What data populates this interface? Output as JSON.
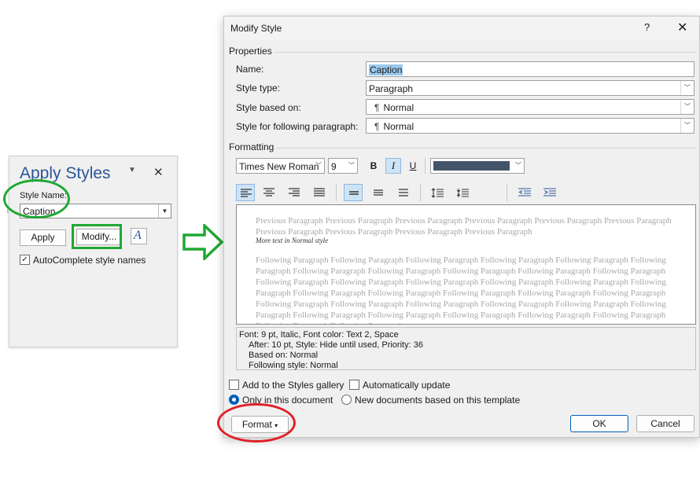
{
  "apply_styles": {
    "title": "Apply Styles",
    "style_name_label": "Style Name:",
    "style_name_value": "Caption",
    "apply_label": "Apply",
    "modify_label": "Modify...",
    "styles_pane_glyph": "A",
    "autocomplete_label": "AutoComplete style names",
    "autocomplete_checked": true
  },
  "dialog": {
    "title": "Modify Style",
    "help": "?",
    "close": "✕",
    "properties_label": "Properties",
    "name_label": "Name:",
    "name_value": "Caption",
    "style_type_label": "Style type:",
    "style_type_value": "Paragraph",
    "based_on_label": "Style based on:",
    "based_on_value": "Normal",
    "following_label": "Style for following paragraph:",
    "following_value": "Normal",
    "formatting_label": "Formatting",
    "font_value": "Times New Roman",
    "size_value": "9",
    "bold": "B",
    "italic": "I",
    "underline": "U",
    "font_color": "#44546a",
    "preview_previous": "Previous Paragraph Previous Paragraph Previous Paragraph Previous Paragraph Previous Paragraph Previous Paragraph Previous Paragraph Previous Paragraph Previous Paragraph Previous Paragraph",
    "preview_sample": "More text in Normal style",
    "preview_following": "Following Paragraph Following Paragraph Following Paragraph Following Paragraph Following Paragraph Following Paragraph Following Paragraph Following Paragraph Following Paragraph Following Paragraph Following Paragraph Following Paragraph Following Paragraph Following Paragraph Following Paragraph Following Paragraph Following Paragraph Following Paragraph Following Paragraph Following Paragraph Following Paragraph Following Paragraph Following Paragraph Following Paragraph Following Paragraph Following Paragraph Following Paragraph Following Paragraph Following Paragraph Following Paragraph Following Paragraph Following Paragraph Following Paragraph Following Paragraph Following Paragraph",
    "desc_line1": "Font: 9 pt, Italic, Font color: Text 2, Space",
    "desc_line2": "After:  10 pt, Style: Hide until used, Priority: 36",
    "desc_line3": "Based on: Normal",
    "desc_line4": "Following style: Normal",
    "add_gallery_label": "Add to the Styles gallery",
    "auto_update_label": "Automatically update",
    "only_doc_label": "Only in this document",
    "new_docs_label": "New documents based on this template",
    "format_label": "Format",
    "ok_label": "OK",
    "cancel_label": "Cancel"
  }
}
